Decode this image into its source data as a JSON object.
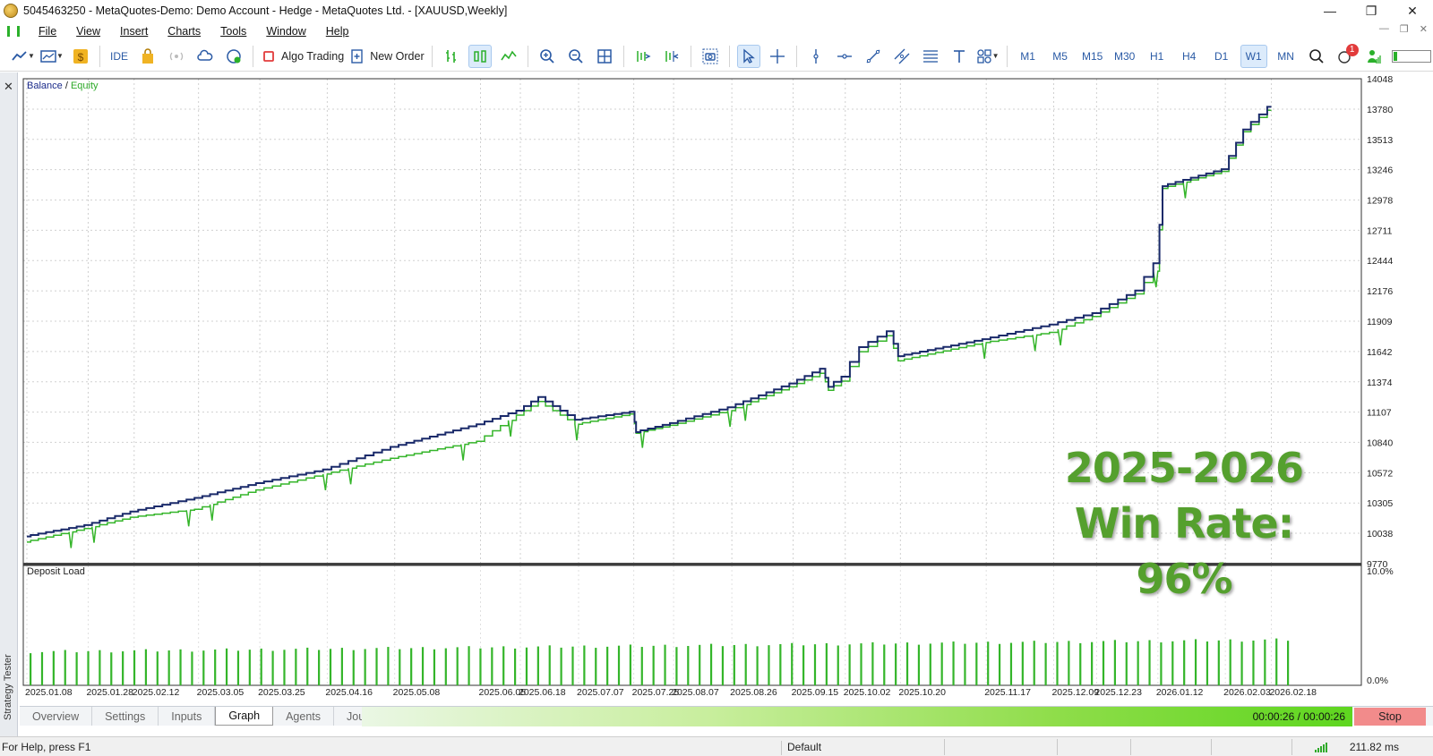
{
  "window": {
    "title": "5045463250 - MetaQuotes-Demo: Demo Account - Hedge - MetaQuotes Ltd. - [XAUUSD,Weekly]",
    "minimize": "—",
    "restore": "❐",
    "close": "✕"
  },
  "menu": {
    "items": [
      "File",
      "View",
      "Insert",
      "Charts",
      "Tools",
      "Window",
      "Help"
    ]
  },
  "toolbar": {
    "ide_label": "IDE",
    "algo_trading_label": "Algo Trading",
    "new_order_label": "New Order",
    "timeframes": [
      "M1",
      "M5",
      "M15",
      "M30",
      "H1",
      "H4",
      "D1",
      "W1",
      "MN"
    ],
    "active_timeframe": "W1",
    "notification_count": "1"
  },
  "side_panel": {
    "close": "✕",
    "label": "Strategy Tester"
  },
  "chart": {
    "legend_balance": "Balance",
    "legend_sep": " / ",
    "legend_equity": "Equity",
    "deposit_load_label": "Deposit Load",
    "overlay_line1": "2025-2026",
    "overlay_line2": "Win Rate: 96%",
    "colors": {
      "balance": "#1a2a6a",
      "equity": "#35b52a",
      "deposit_bars": "#34b52a",
      "overlay": "#55a02e"
    }
  },
  "chart_data": {
    "type": "line",
    "title": "",
    "ylabel": "",
    "xlabel": "",
    "y_ticks": [
      14048,
      13780,
      13513,
      13246,
      12978,
      12711,
      12444,
      12176,
      11909,
      11642,
      11374,
      11107,
      10840,
      10572,
      10305,
      10038,
      9770
    ],
    "ylim": [
      9770,
      14048
    ],
    "x_tick_labels": [
      "2025.01.08",
      "2025.01.28",
      "2025.02.12",
      "2025.03.05",
      "2025.03.25",
      "2025.04.16",
      "2025.05.08",
      "2025.06.05",
      "2025.06.18",
      "2025.07.07",
      "2025.07.25",
      "2025.08.07",
      "2025.08.26",
      "2025.09.15",
      "2025.10.02",
      "2025.10.20",
      "2025.11.17",
      "2025.12.09",
      "2025.12.23",
      "2026.01.12",
      "2026.02.03",
      "2026.02.18"
    ],
    "series": [
      {
        "name": "Balance",
        "x": [
          "2025.01.08",
          "2025.01.28",
          "2025.02.12",
          "2025.03.05",
          "2025.03.25",
          "2025.04.16",
          "2025.05.08",
          "2025.06.05",
          "2025.06.18",
          "2025.06.25",
          "2025.07.07",
          "2025.07.25",
          "2025.07.26",
          "2025.08.07",
          "2025.08.26",
          "2025.09.15",
          "2025.09.25",
          "2025.09.27",
          "2025.10.02",
          "2025.10.08",
          "2025.10.17",
          "2025.10.20",
          "2025.11.17",
          "2025.12.09",
          "2025.12.23",
          "2026.01.06",
          "2026.01.12",
          "2026.01.14",
          "2026.02.03",
          "2026.02.10",
          "2026.02.18"
        ],
        "values": [
          10010,
          10110,
          10230,
          10350,
          10480,
          10600,
          10800,
          11000,
          11120,
          11240,
          11040,
          11110,
          10930,
          11010,
          11150,
          11360,
          11490,
          11330,
          11420,
          11680,
          11820,
          11600,
          11750,
          11880,
          11980,
          12180,
          12420,
          13100,
          13250,
          13600,
          13800
        ]
      },
      {
        "name": "Equity",
        "x": [
          "2025.01.08",
          "2025.01.28",
          "2025.02.12",
          "2025.03.05",
          "2025.03.25",
          "2025.04.16",
          "2025.05.08",
          "2025.06.05",
          "2025.06.18",
          "2025.06.25",
          "2025.07.07",
          "2025.07.25",
          "2025.07.26",
          "2025.08.07",
          "2025.08.26",
          "2025.09.15",
          "2025.09.25",
          "2025.09.27",
          "2025.10.02",
          "2025.10.08",
          "2025.10.17",
          "2025.10.20",
          "2025.11.17",
          "2025.12.09",
          "2025.12.23",
          "2026.01.06",
          "2026.01.12",
          "2026.01.14",
          "2026.02.03",
          "2026.02.10",
          "2026.02.18"
        ],
        "values": [
          9960,
          10080,
          10180,
          10250,
          10420,
          10560,
          10700,
          10850,
          11080,
          11200,
          11000,
          11090,
          10920,
          10990,
          11120,
          11330,
          11450,
          11300,
          11380,
          11640,
          11780,
          11560,
          11720,
          11810,
          11950,
          12150,
          12350,
          13080,
          13230,
          13580,
          13770
        ]
      }
    ],
    "deposit_load": {
      "label": "Deposit Load",
      "y_ticks": [
        "10.0%",
        "0.0%"
      ],
      "ylim": [
        0,
        10
      ],
      "bars": 110,
      "approx_level_start": 2.8,
      "approx_level_end": 3.8
    },
    "grid": true
  },
  "tester_tabs": {
    "items": [
      "Overview",
      "Settings",
      "Inputs",
      "Graph",
      "Agents",
      "Journal"
    ],
    "active": "Graph",
    "progress_text": "00:00:26 / 00:00:26",
    "progress": 1.0,
    "stop_label": "Stop"
  },
  "statusbar": {
    "help": "For Help, press F1",
    "profile": "Default",
    "ping": "211.82 ms"
  }
}
